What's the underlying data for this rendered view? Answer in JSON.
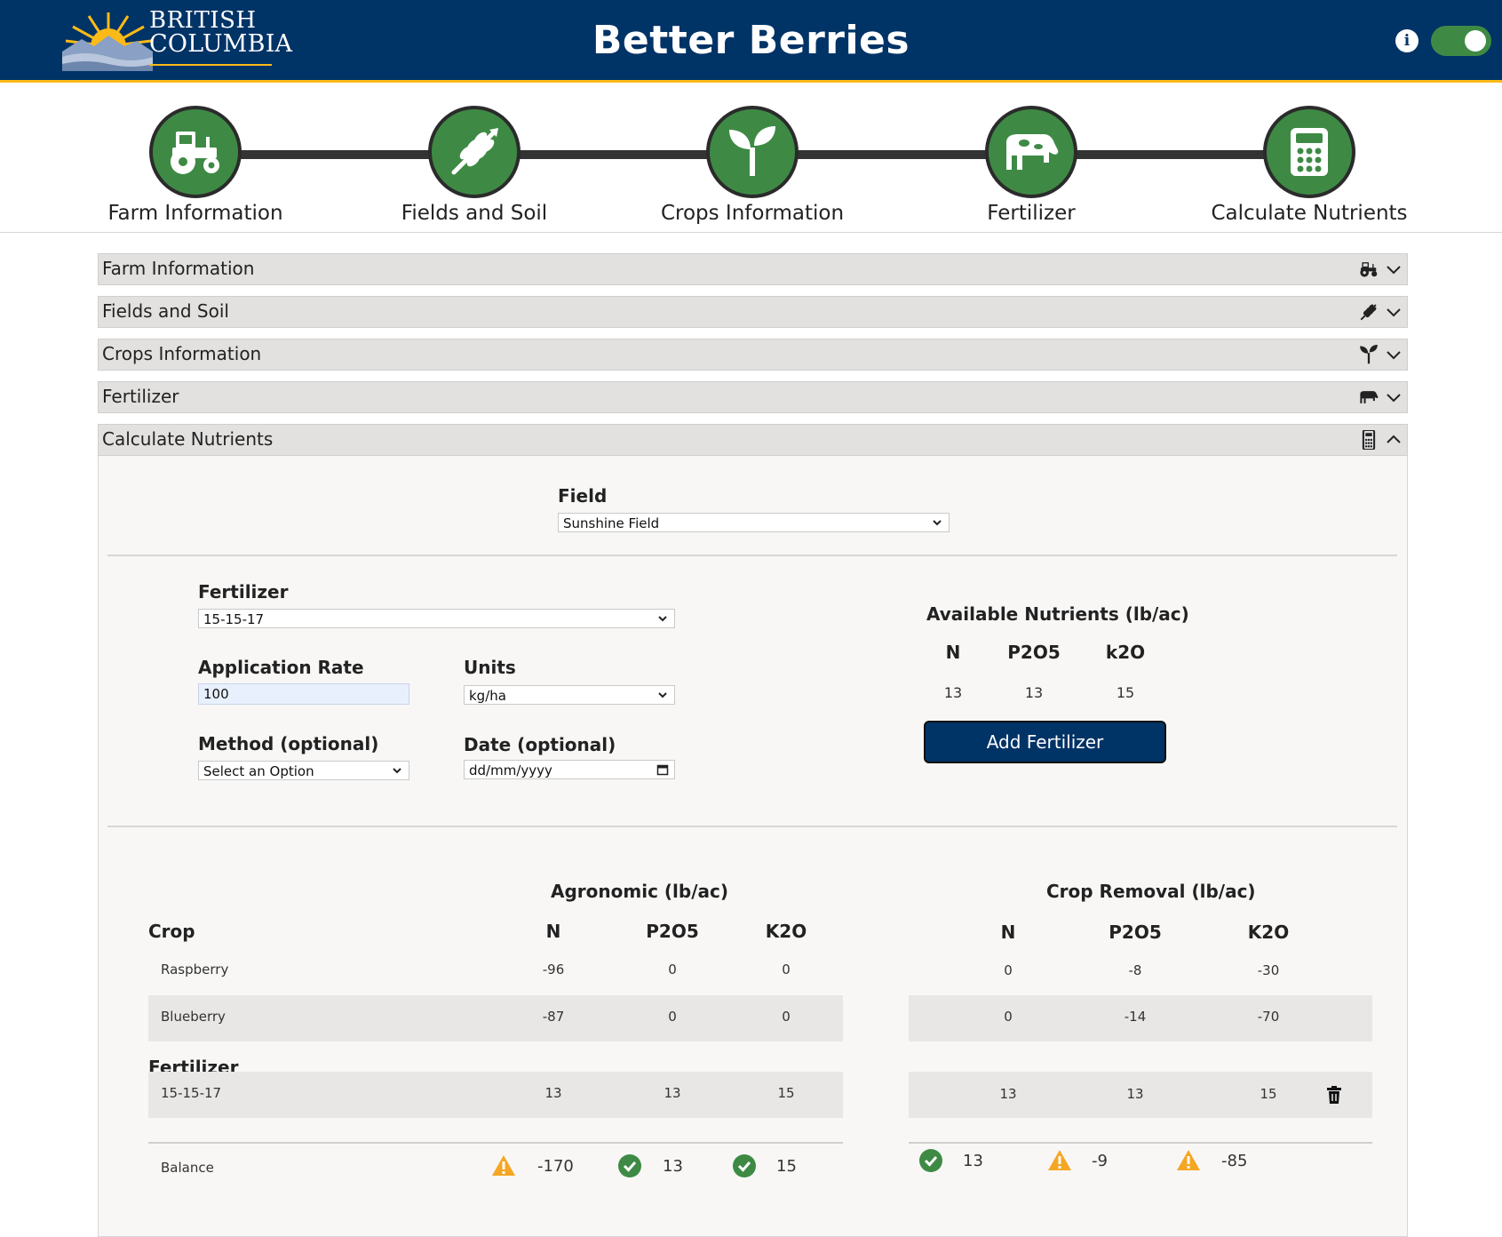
{
  "header": {
    "logo_line1": "BRITISH",
    "logo_line2": "COLUMBIA",
    "title": "Better Berries",
    "colors": {
      "primary": "#003366",
      "accent": "#fcba19",
      "green": "#3e8a45",
      "warning": "#f5a623"
    }
  },
  "stepper": {
    "steps": [
      {
        "label": "Farm Information",
        "icon": "tractor-icon"
      },
      {
        "label": "Fields and Soil",
        "icon": "wheat-icon"
      },
      {
        "label": "Crops Information",
        "icon": "seedling-icon"
      },
      {
        "label": "Fertilizer",
        "icon": "cow-icon"
      },
      {
        "label": "Calculate Nutrients",
        "icon": "calculator-icon"
      }
    ]
  },
  "accordion": [
    {
      "title": "Farm Information",
      "icon": "tractor-icon",
      "expanded": false
    },
    {
      "title": "Fields and Soil",
      "icon": "wheat-icon",
      "expanded": false
    },
    {
      "title": "Crops Information",
      "icon": "seedling-icon",
      "expanded": false
    },
    {
      "title": "Fertilizer",
      "icon": "cow-icon",
      "expanded": false
    },
    {
      "title": "Calculate Nutrients",
      "icon": "calculator-icon",
      "expanded": true
    }
  ],
  "form": {
    "field_label": "Field",
    "field_value": "Sunshine Field",
    "fertilizer_label": "Fertilizer",
    "fertilizer_value": "15-15-17",
    "rate_label": "Application Rate",
    "rate_value": "100",
    "units_label": "Units",
    "units_value": "kg/ha",
    "method_label": "Method (optional)",
    "method_value": "Select an Option",
    "date_label": "Date (optional)",
    "date_value": "dd/mm/yyyy"
  },
  "available": {
    "title": "Available Nutrients (lb/ac)",
    "headers": [
      "N",
      "P2O5",
      "k2O"
    ],
    "values": [
      "13",
      "13",
      "15"
    ],
    "add_button": "Add Fertilizer"
  },
  "results": {
    "agronomic_title": "Agronomic (lb/ac)",
    "removal_title": "Crop Removal (lb/ac)",
    "crop_header": "Crop",
    "agro_headers": [
      "N",
      "P2O5",
      "K2O"
    ],
    "removal_headers": [
      "N",
      "P2O5",
      "K2O"
    ],
    "crops": [
      {
        "name": "Raspberry",
        "agro": [
          "-96",
          "0",
          "0"
        ],
        "removal": [
          "0",
          "-8",
          "-30"
        ]
      },
      {
        "name": "Blueberry",
        "agro": [
          "-87",
          "0",
          "0"
        ],
        "removal": [
          "0",
          "-14",
          "-70"
        ]
      }
    ],
    "fertilizer_header": "Fertilizer",
    "fertilizers": [
      {
        "name": "15-15-17",
        "agro": [
          "13",
          "13",
          "15"
        ],
        "removal": [
          "13",
          "13",
          "15"
        ]
      }
    ],
    "balance_label": "Balance",
    "balance_agro": [
      {
        "value": "-170",
        "status": "warning"
      },
      {
        "value": "13",
        "status": "ok"
      },
      {
        "value": "15",
        "status": "ok"
      }
    ],
    "balance_removal": [
      {
        "value": "13",
        "status": "ok"
      },
      {
        "value": "-9",
        "status": "warning"
      },
      {
        "value": "-85",
        "status": "warning"
      }
    ]
  }
}
